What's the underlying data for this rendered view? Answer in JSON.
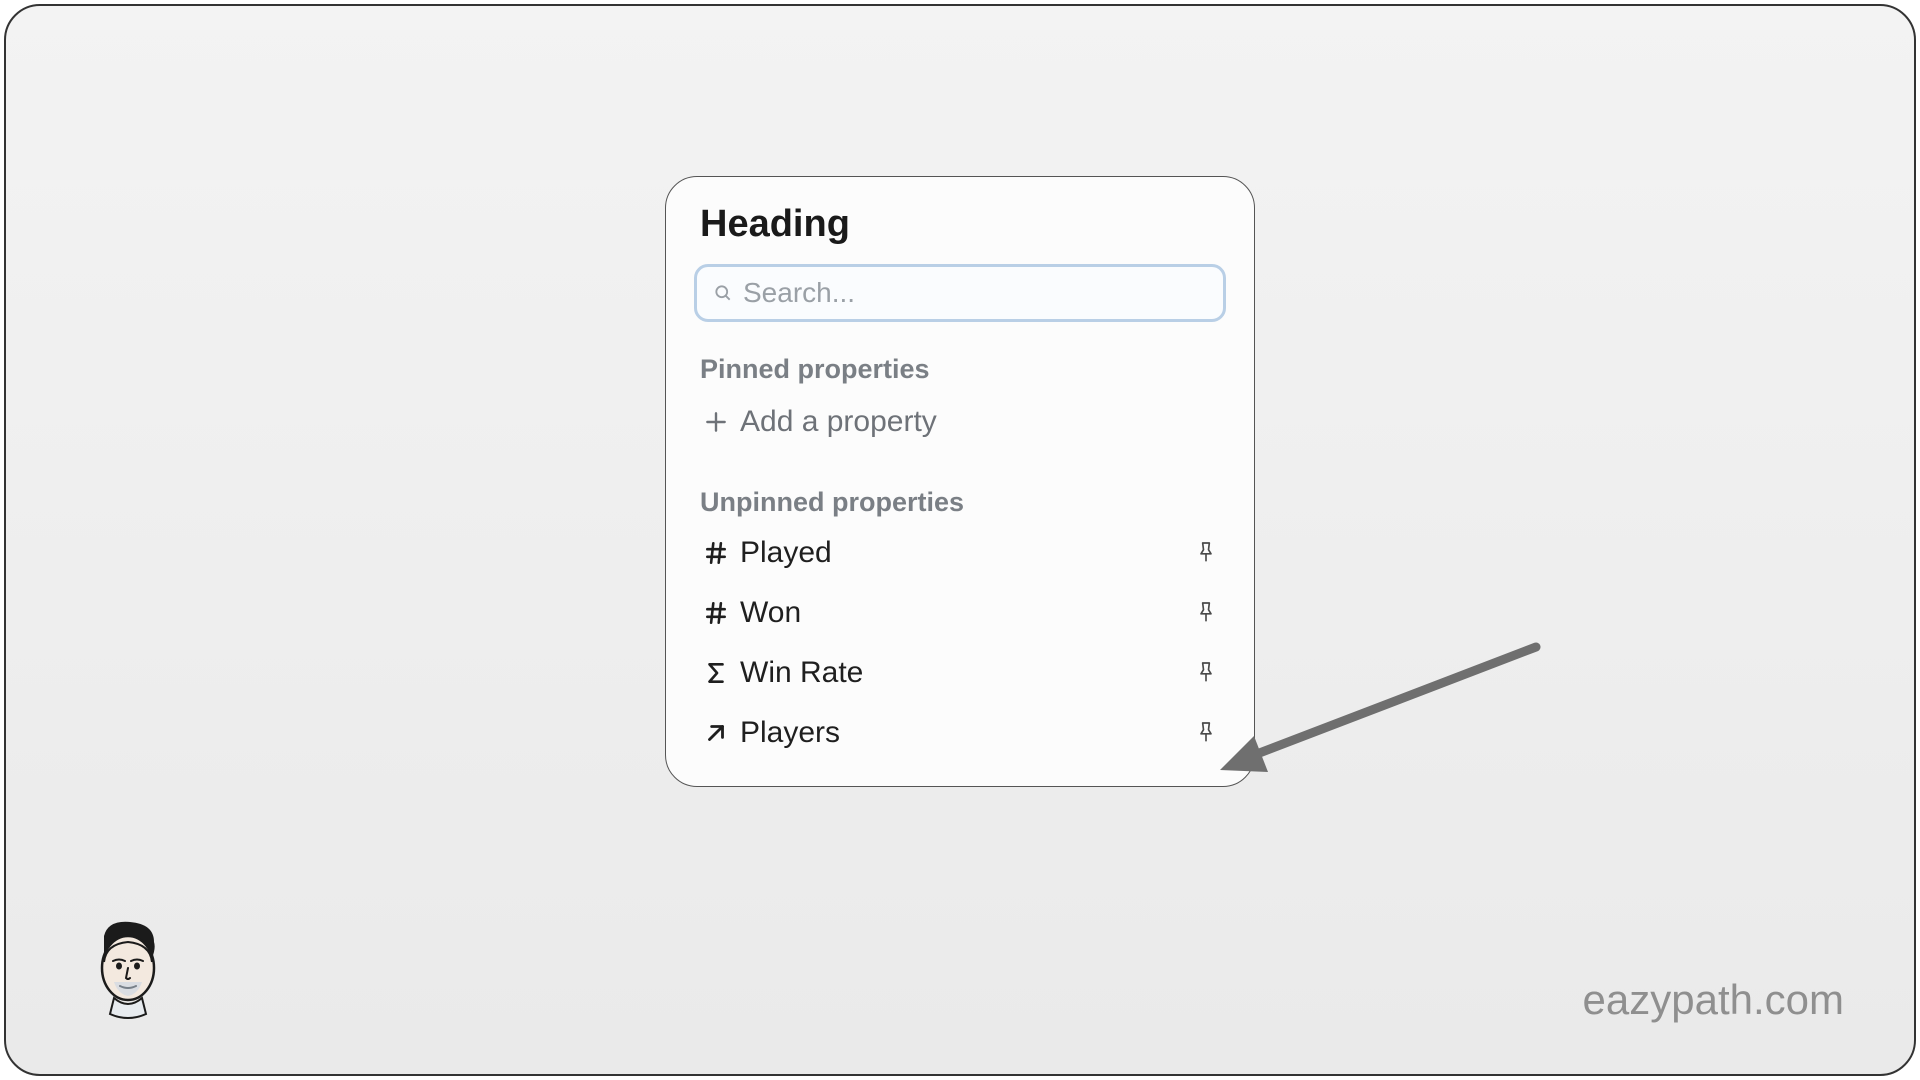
{
  "popup": {
    "title": "Heading",
    "search": {
      "placeholder": "Search..."
    },
    "pinned": {
      "label": "Pinned properties",
      "add_label": "Add a property"
    },
    "unpinned": {
      "label": "Unpinned properties",
      "items": [
        {
          "icon": "hash",
          "label": "Played"
        },
        {
          "icon": "hash",
          "label": "Won"
        },
        {
          "icon": "sigma",
          "label": "Win Rate"
        },
        {
          "icon": "arrow-up-right",
          "label": "Players"
        }
      ]
    }
  },
  "watermark": "eazypath.com"
}
